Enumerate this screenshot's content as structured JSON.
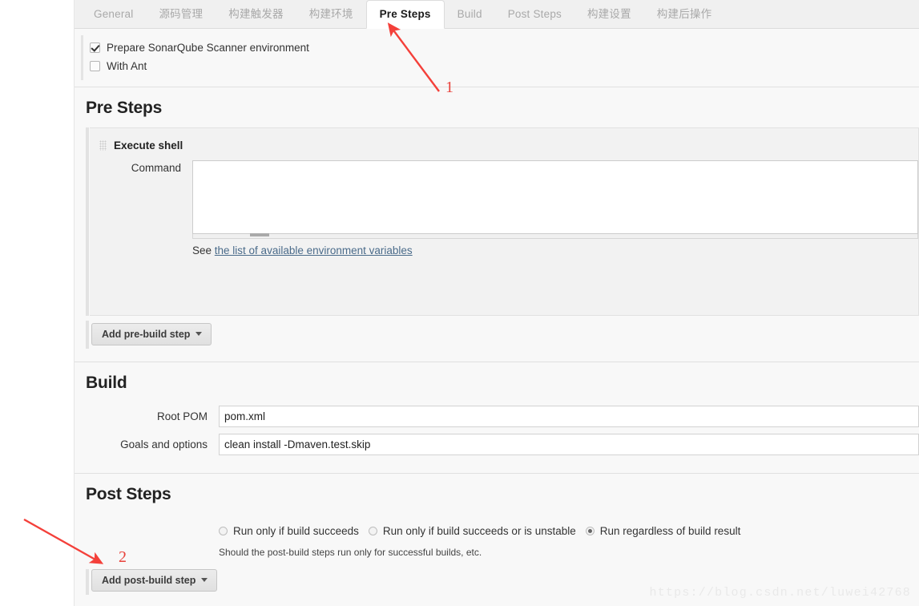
{
  "tabs": [
    {
      "label": "General",
      "active": false
    },
    {
      "label": "源码管理",
      "active": false
    },
    {
      "label": "构建触发器",
      "active": false
    },
    {
      "label": "构建环境",
      "active": false
    },
    {
      "label": "Pre Steps",
      "active": true
    },
    {
      "label": "Build",
      "active": false
    },
    {
      "label": "Post Steps",
      "active": false
    },
    {
      "label": "构建设置",
      "active": false
    },
    {
      "label": "构建后操作",
      "active": false
    }
  ],
  "env": {
    "checkboxes": [
      {
        "label": "Prepare SonarQube Scanner environment",
        "checked": true
      },
      {
        "label": "With Ant",
        "checked": false
      }
    ]
  },
  "pre_steps": {
    "title": "Pre Steps",
    "builder": {
      "name": "Execute shell",
      "grip_icon": "drag-grip-icon",
      "command_label": "Command",
      "command_value": "",
      "command_placeholder": "",
      "help_prefix": "See ",
      "help_link": "the list of available environment variables"
    },
    "add_button": "Add pre-build step"
  },
  "build": {
    "title": "Build",
    "fields": [
      {
        "label": "Root POM",
        "value": "pom.xml"
      },
      {
        "label": "Goals and options",
        "value": "clean install -Dmaven.test.skip"
      }
    ]
  },
  "post_steps": {
    "title": "Post Steps",
    "radios": [
      {
        "label": "Run only if build succeeds",
        "selected": false
      },
      {
        "label": "Run only if build succeeds or is unstable",
        "selected": false
      },
      {
        "label": "Run regardless of build result",
        "selected": true
      }
    ],
    "help": "Should the post-build steps run only for successful builds, etc.",
    "add_button": "Add post-build step"
  },
  "annotations": [
    {
      "number": "1"
    },
    {
      "number": "2"
    }
  ],
  "watermark": "https://blog.csdn.net/luwei42768",
  "colors": {
    "accent_red": "#e8413a",
    "link": "#4a6b8a",
    "page_bg": "#f8f8f8"
  }
}
